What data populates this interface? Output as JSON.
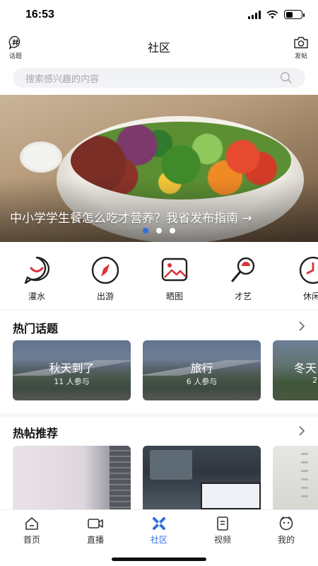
{
  "status": {
    "time": "16:53"
  },
  "header": {
    "title": "社区",
    "left_label": "话题",
    "right_label": "发帖"
  },
  "search": {
    "placeholder": "搜索感兴趣的内容"
  },
  "banner": {
    "caption": "中小学学生餐怎么吃才营养？我省发布指南 →",
    "dots": 3,
    "active_dot": 0
  },
  "categories": [
    {
      "label": "灌水",
      "icon": "smile-icon"
    },
    {
      "label": "出游",
      "icon": "compass-icon"
    },
    {
      "label": "晒图",
      "icon": "image-icon"
    },
    {
      "label": "才艺",
      "icon": "microphone-icon"
    },
    {
      "label": "休闲",
      "icon": "clock-icon"
    }
  ],
  "hot_topics": {
    "title": "热门话题",
    "items": [
      {
        "title": "秋天到了",
        "sub": "11 人参与"
      },
      {
        "title": "旅行",
        "sub": "6 人参与"
      },
      {
        "title": "冬天",
        "sub": "2"
      }
    ]
  },
  "hot_posts": {
    "title": "热帖推荐"
  },
  "tabbar": {
    "items": [
      {
        "label": "首页",
        "icon": "home-icon"
      },
      {
        "label": "直播",
        "icon": "live-camera-icon"
      },
      {
        "label": "社区",
        "icon": "community-icon"
      },
      {
        "label": "视频",
        "icon": "video-icon"
      },
      {
        "label": "我的",
        "icon": "profile-icon"
      }
    ],
    "active_index": 2
  },
  "colors": {
    "accent": "#2f6ee0",
    "icon_red": "#d8333a",
    "text": "#222222"
  }
}
